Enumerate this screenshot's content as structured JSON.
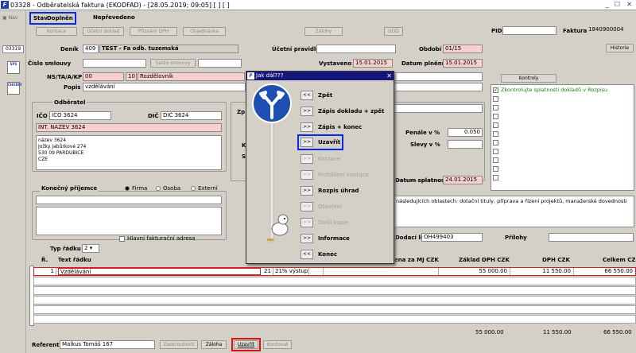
{
  "window": {
    "title": "03328 - Odběratelská faktura (EKODFAD) - [28.05.2019; 09:05]  [ ]  [ ]",
    "app_icon": "F",
    "min": "_",
    "max": "☐",
    "close": "✕"
  },
  "sidebar": {
    "nav": "Nav",
    "doc_id": "03319",
    "icon1": "SPS",
    "icon2": "ČHODLY"
  },
  "status": {
    "label": "Stav",
    "value": "Doplněn",
    "transfer": "Nepřevedeno"
  },
  "toolbar": {
    "kontace": "Kontace",
    "ucetni_doklad": "Účetní doklad",
    "prizani_dph": "Přiznání DPH",
    "objednavka": "Objednávka",
    "zalohy": "Zálohy",
    "udd": "UDD"
  },
  "header": {
    "pid_label": "PID",
    "pid_value": "",
    "faktura_label": "Faktura",
    "faktura_value": "1840900004",
    "historie": "Historie"
  },
  "form": {
    "denik_label": "Deník",
    "denik_code": "409",
    "denik_name": "TEST - Fa odb. tuzemská",
    "ucetni_pravidlo_label": "Účetní pravidlo",
    "obdobi_label": "Období",
    "obdobi_value": "01/15",
    "cislo_smlouvy_label": "Číslo smlouvy",
    "saldo_smlouvy": "Saldo smlouvy",
    "vystaveno_label": "Vystaveno",
    "vystaveno_value": "15.01.2015",
    "datum_plneni_label": "Datum plnění",
    "datum_plneni_value": "15.01.2015",
    "ns_label": "NS/TA/A/KP",
    "ns_value": "00",
    "ns_code": "10",
    "ns_name": "Rozdělovník",
    "popis_label": "Popis",
    "popis_value": "vzdělávání",
    "splatnost_label": "Datum splatnosti",
    "splatnost_value": "24.01.2015",
    "penale_label": "Penále v %",
    "penale_value": "0.050",
    "slevy_label": "Slevy v %",
    "dodaci_list_label": "Dodací list",
    "dodaci_list_value": "OH499403",
    "prilohy_label": "Přílohy",
    "note_text": "následujících oblastech: dotační tituly, příprava a řízení projektů, manažerské dovednosti"
  },
  "kontroly": {
    "button": "Kontroly",
    "item": "Zkontrolujte splatnosti dokladů v Rozpisu"
  },
  "odberatel": {
    "group": "Odběratel",
    "ico_label": "IČO",
    "ico_value": "IČO 3624",
    "dic_label": "DIČ",
    "dic_value": "DIČ 3624",
    "int_name": "INT. NÁZEV 3624",
    "address": [
      "název 3624",
      "Jožky Jabůrkové 274",
      "530 09 PARDUBICE",
      "CZE"
    ]
  },
  "prijemce": {
    "group": "Konečný příjemce",
    "firma": "Firma",
    "osoba": "Osoba",
    "externi": "Externí",
    "hlavni_adresa": "Hlavní fakturační adresa"
  },
  "dialog": {
    "title": "Jak dál???",
    "items": [
      {
        "btn": "<<",
        "label": "Zpět",
        "enabled": true
      },
      {
        "btn": ">>",
        "label": "Zápis dokladu + zpět",
        "enabled": true
      },
      {
        "btn": ">>",
        "label": "Zápis + konec",
        "enabled": true
      },
      {
        "btn": ">>",
        "label": "Uzavřít",
        "enabled": true
      },
      {
        "btn": ">>",
        "label": "Kontace",
        "enabled": false
      },
      {
        "btn": ">>",
        "label": "Prohlížení kontace",
        "enabled": false
      },
      {
        "btn": ">>",
        "label": "Rozpis úhrad",
        "enabled": true
      },
      {
        "btn": ">>",
        "label": "Otevření",
        "enabled": false
      },
      {
        "btn": ">>",
        "label": "Další kopie",
        "enabled": false
      },
      {
        "btn": ">>",
        "label": "Informace",
        "enabled": true
      },
      {
        "btn": "<<",
        "label": "Konec",
        "enabled": true
      }
    ]
  },
  "table": {
    "typ_radku_label": "Typ řádku",
    "typ_radku_value": "2",
    "col_r": "Ř.",
    "col_text": "Text řádku",
    "col_cena": "ena za MJ CZK",
    "col_zaklad": "Základ DPH CZK",
    "col_dph": "DPH CZK",
    "col_celkem": "Celkem CZK",
    "rows": [
      {
        "n": "1",
        "text": "Vzdělávání",
        "dph_code": "21",
        "dph_name": "21% výstup",
        "zaklad": "55 000.00",
        "dph": "11 550.00",
        "celkem": "66 550.00"
      }
    ],
    "totals": {
      "zaklad": "55 000.00",
      "dph": "11 550.00",
      "celkem": "66 550.00"
    }
  },
  "footer": {
    "referent_label": "Referent",
    "referent_value": "Malkus Tomáš 167",
    "zaokrouhleni": "Zaokrouhlení",
    "zaloha": "Záloha",
    "uzavrit": "Uzavřít",
    "kontovat": "Kontovat"
  }
}
